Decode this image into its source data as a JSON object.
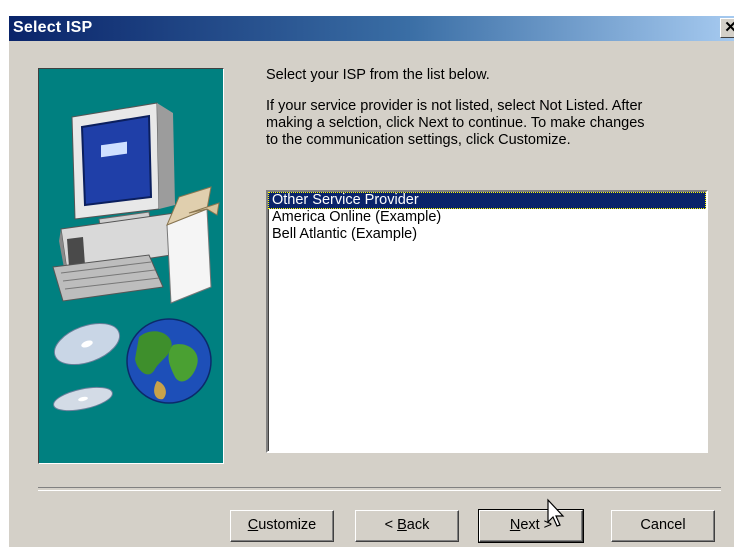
{
  "window": {
    "title": "Select ISP",
    "close_glyph": "✕"
  },
  "instructions": {
    "heading": "Select your ISP from the list below.",
    "line1": "If your service provider is not listed, select Not Listed.  After",
    "line2": "making a selction, click Next to continue.  To make changes",
    "line3": "to the communication settings, click Customize."
  },
  "isp_list": {
    "items": [
      "Other Service Provider",
      "America Online (Example)",
      "Bell Atlantic (Example)"
    ],
    "selected_index": 0
  },
  "buttons": {
    "customize": {
      "label_mnemonic": "C",
      "label_rest": "ustomize"
    },
    "back": {
      "label_prefix": "< ",
      "label_mnemonic": "B",
      "label_rest": "ack"
    },
    "next": {
      "label_mnemonic": "N",
      "label_rest": "ext >"
    },
    "cancel": {
      "label": "Cancel"
    }
  },
  "colors": {
    "title_bar_start": "#0a246a",
    "panel_teal": "#008080",
    "selection": "#0a246a",
    "dialog_face": "#d4d0c8"
  },
  "icons": [
    "close-icon",
    "computer-illustration",
    "globe-icon",
    "cd-disc-icon",
    "mouse-cursor-icon"
  ]
}
